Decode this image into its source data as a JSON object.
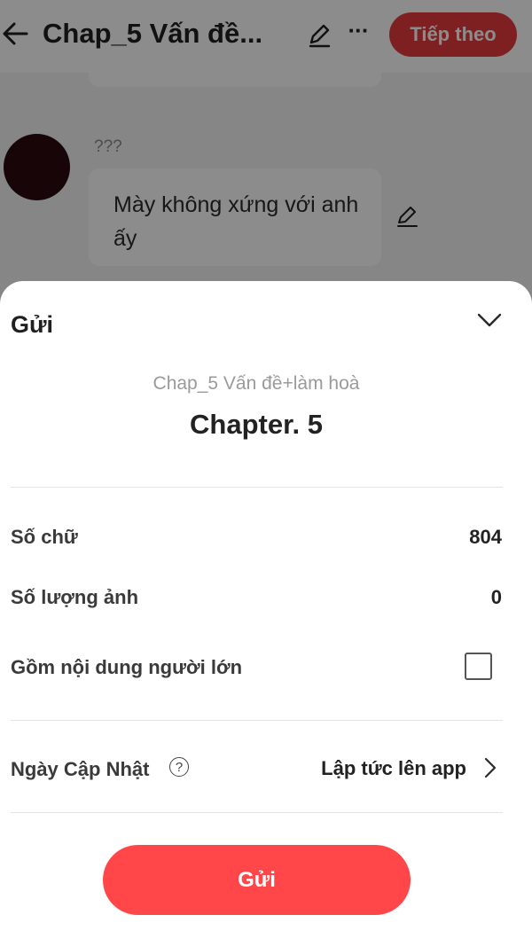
{
  "header": {
    "chapter_title": "Chap_5 Vấn đề...",
    "more_label": "···",
    "next_button": "Tiếp theo"
  },
  "chat": {
    "speaker_name": "???",
    "message": "Mày không xứng với anh ấy"
  },
  "sheet": {
    "title": "Gửi",
    "subtitle": "Chap_5 Vấn đề+làm hoà",
    "chapter_name": "Chapter. 5",
    "rows": {
      "word_count_label": "Số chữ",
      "word_count_value": "804",
      "image_count_label": "Số lượng ảnh",
      "image_count_value": "0",
      "adult_content_label": "Gồm nội dung người lớn",
      "update_date_label": "Ngày Cập Nhật",
      "update_date_help": "?",
      "update_date_value": "Lập tức lên app"
    },
    "submit_button": "Gửi"
  },
  "state": {
    "adult_content_checked": false
  },
  "colors": {
    "accent": "#ff474a",
    "next_button": "#e53b3e",
    "overlay": "rgba(0,0,0,0.45)"
  },
  "icons": {
    "back": "arrow-left-icon",
    "edit": "pencil-icon",
    "more": "more-dots-icon",
    "collapse": "chevron-down-icon",
    "help": "question-circle-icon",
    "forward": "chevron-right-icon"
  }
}
